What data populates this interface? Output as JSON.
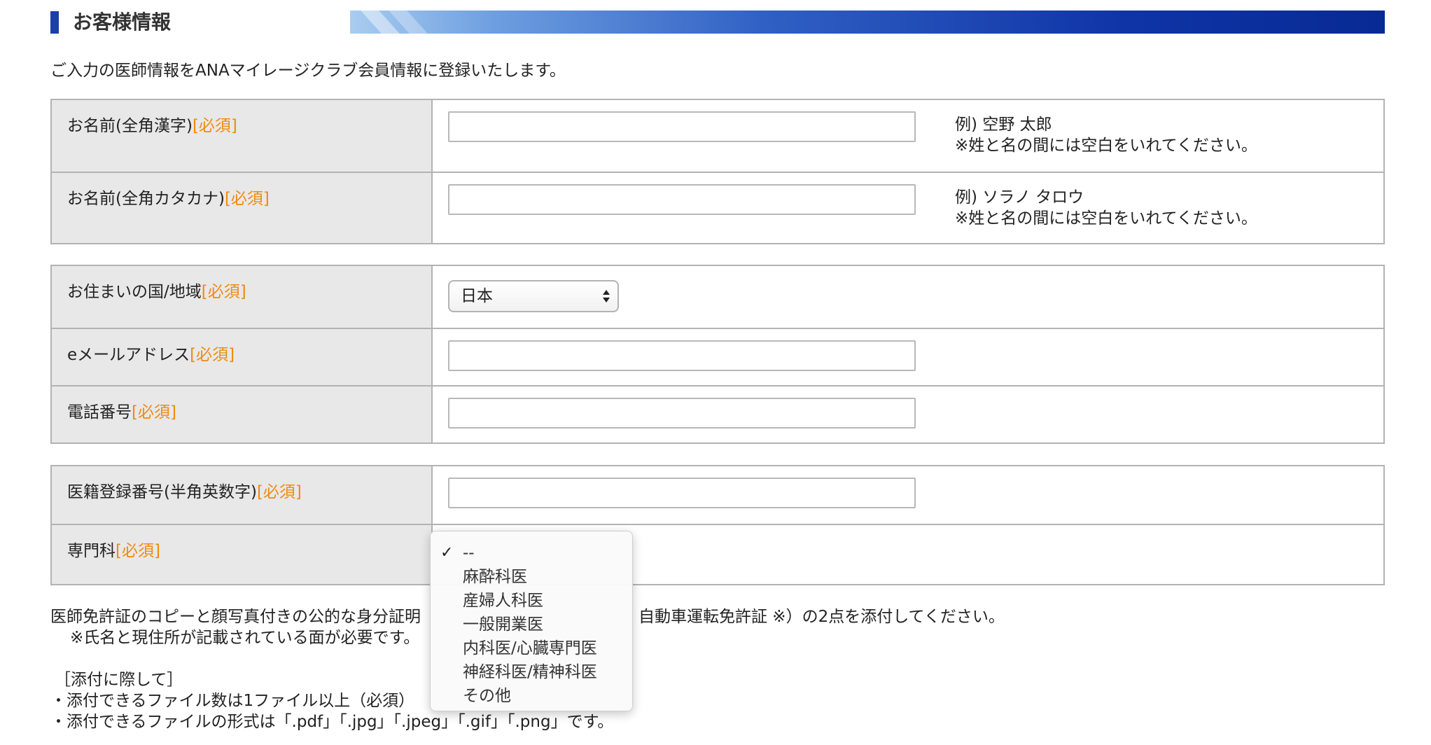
{
  "section": {
    "title": "お客様情報"
  },
  "intro_text": "ご入力の医師情報をANAマイレージクラブ会員情報に登録いたします。",
  "required_mark": "[必須]",
  "group1": {
    "name_kanji": {
      "label": "お名前(全角漢字)",
      "value": "",
      "note_line1": "例) 空野 太郎",
      "note_line2": "※姓と名の間には空白をいれてください。"
    },
    "name_kana": {
      "label": "お名前(全角カタカナ)",
      "value": "",
      "note_line1": "例) ソラノ タロウ",
      "note_line2": "※姓と名の間には空白をいれてください。"
    }
  },
  "group2": {
    "country": {
      "label": "お住まいの国/地域",
      "selected": "日本"
    },
    "email": {
      "label": "eメールアドレス",
      "value": ""
    },
    "phone": {
      "label": "電話番号",
      "value": ""
    }
  },
  "group3": {
    "registration_number": {
      "label": "医籍登録番号(半角英数字)",
      "value": ""
    },
    "specialty": {
      "label": "専門科"
    }
  },
  "specialty_dropdown": {
    "selected_index": 0,
    "options": [
      "--",
      "麻酔科医",
      "産婦人科医",
      "一般開業医",
      "内科医/心臓専門医",
      "神経科医/精神科医",
      "その他"
    ]
  },
  "bottom": {
    "line1_left": "医師免許証のコピーと顔写真付きの公的な身分証明",
    "line1_right": "自動車運転免許証 ※）の2点を添付してください。",
    "line2": "※氏名と現住所が記載されている面が必要です。",
    "line3": "［添付に際して］",
    "line4": "・添付できるファイル数は1ファイル以上（必須）",
    "line5": "・添付できるファイルの形式は「.pdf」「.jpg」「.jpeg」「.gif」「.png」です。"
  }
}
